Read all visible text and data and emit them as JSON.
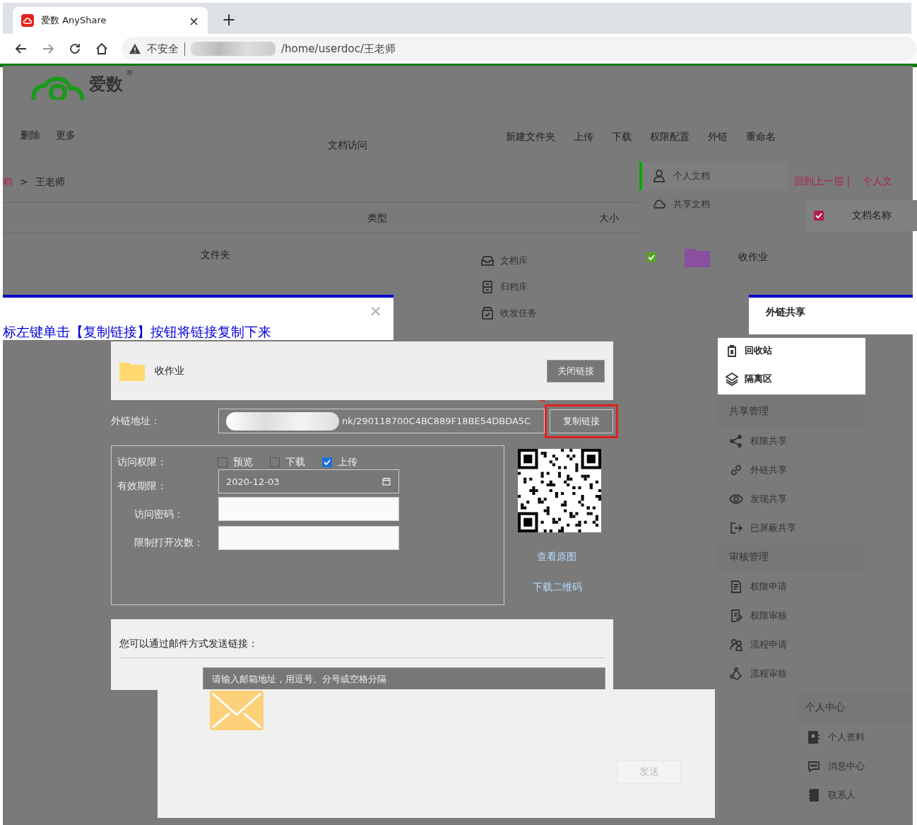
{
  "browser": {
    "tab_title": "爱数 AnyShare",
    "tab_close": "×",
    "new_tab": "+",
    "security": "不安全",
    "url": "/home/userdoc/王老师"
  },
  "logo": {
    "name": "爱数",
    "mark": "®"
  },
  "toolbar": {
    "left": [
      "删除",
      "更多"
    ],
    "center": "文档访问",
    "right": [
      "新建文件夹",
      "上传",
      "下载",
      "权限配置",
      "外链",
      "重命名"
    ]
  },
  "breadcrumb": [
    "档",
    ">",
    "王老师"
  ],
  "table": {
    "columns": [
      "类型",
      "大小"
    ],
    "rows": [
      {
        "type": "文件夹"
      }
    ]
  },
  "nav": [
    {
      "label": "个人文档",
      "selected": true
    },
    {
      "label": "共享文档",
      "selected": false
    }
  ],
  "library_nav": [
    "文档库",
    "归档库",
    "收发任务"
  ],
  "back": {
    "up": "回到上一层 |",
    "crumb": "个人文"
  },
  "file_list": {
    "header": {
      "checked": true,
      "label": "文档名称"
    },
    "rows": [
      {
        "checked": true,
        "name": "收作业"
      }
    ]
  },
  "tip": {
    "close": "×",
    "text": "标左键单击【复制链接】按钮将链接复制下来"
  },
  "link_dialog_title": "外链共享",
  "share": {
    "folder": "收作业",
    "close_link": "关闭链接",
    "address_label": "外链地址：",
    "address": "nk/290118700C4BC889F18BE54DBDA5C",
    "copy": "复制链接",
    "access_label": "访问权限：",
    "permissions": [
      {
        "label": "预览",
        "checked": false
      },
      {
        "label": "下载",
        "checked": false
      },
      {
        "label": "上传",
        "checked": true
      }
    ],
    "expiry_label": "有效期限：",
    "expiry": "2020-12-03",
    "password_label": "访问密码：",
    "limit_label": "限制打开次数：",
    "view_original": "查看原图",
    "download_qr": "下载二维码",
    "email_text": "您可以通过邮件方式发送链接：",
    "email_placeholder": "请输入邮箱地址，用逗号、分号或空格分隔",
    "send": "发送"
  },
  "sidebar": {
    "top": [
      "回收站",
      "隔离区"
    ],
    "groups": [
      {
        "title": "共享管理",
        "items": [
          "权限共享",
          "外链共享",
          "发现共享",
          "已屏蔽共享"
        ]
      },
      {
        "title": "审核管理",
        "items": [
          "权限申请",
          "权限审核",
          "流程申请",
          "流程审核"
        ]
      }
    ],
    "personal": {
      "title": "个人中心",
      "items": [
        "个人资料",
        "消息中心",
        "联系人"
      ]
    }
  }
}
